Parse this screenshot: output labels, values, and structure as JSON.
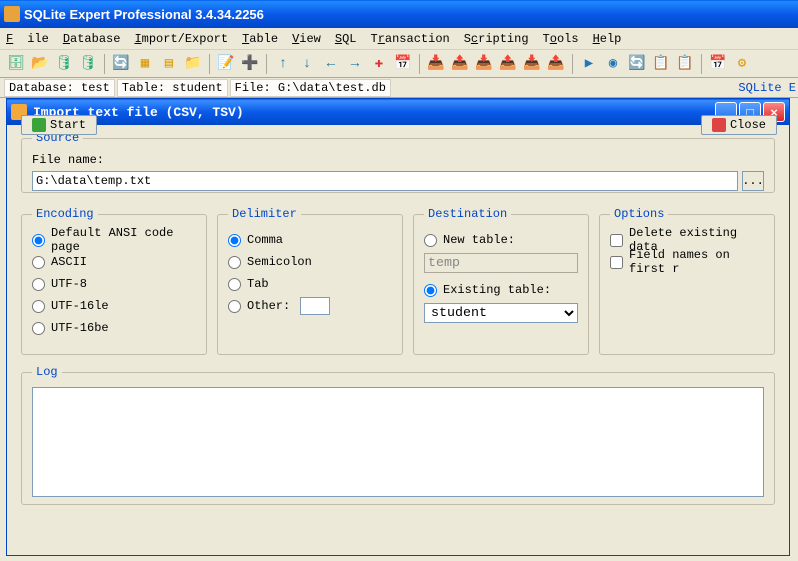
{
  "app": {
    "title": "SQLite Expert Professional 3.4.34.2256"
  },
  "menu": {
    "file": "File",
    "database": "Database",
    "import_export": "Import/Export",
    "table": "Table",
    "view": "View",
    "sql": "SQL",
    "transaction": "Transaction",
    "scripting": "Scripting",
    "tools": "Tools",
    "help": "Help"
  },
  "statusbar": {
    "database_label": "Database:",
    "database_value": "test",
    "table_label": "Table:",
    "table_value": "student",
    "file_label": "File:",
    "file_value": "G:\\data\\test.db",
    "brand": "SQLite E"
  },
  "dialog": {
    "title": "Import text file (CSV, TSV)",
    "source": {
      "legend": "Source",
      "file_name_label": "File name:",
      "file_name_value": "G:\\data\\temp.txt",
      "browse_label": "..."
    },
    "encoding": {
      "legend": "Encoding",
      "options": [
        {
          "label": "Default ANSI code page",
          "checked": true
        },
        {
          "label": "ASCII",
          "checked": false
        },
        {
          "label": "UTF-8",
          "checked": false
        },
        {
          "label": "UTF-16le",
          "checked": false
        },
        {
          "label": "UTF-16be",
          "checked": false
        }
      ]
    },
    "delimiter": {
      "legend": "Delimiter",
      "options": [
        {
          "label": "Comma",
          "checked": true
        },
        {
          "label": "Semicolon",
          "checked": false
        },
        {
          "label": "Tab",
          "checked": false
        },
        {
          "label": "Other:",
          "checked": false
        }
      ],
      "other_value": ""
    },
    "destination": {
      "legend": "Destination",
      "new_table_label": "New table:",
      "new_table_value": "temp",
      "new_table_checked": false,
      "existing_table_label": "Existing table:",
      "existing_table_checked": true,
      "existing_table_value": "student"
    },
    "options": {
      "legend": "Options",
      "delete_existing_label": "Delete existing data",
      "delete_existing_checked": false,
      "field_names_label": "Field names on first r",
      "field_names_checked": false
    },
    "log": {
      "legend": "Log",
      "value": ""
    },
    "buttons": {
      "start": "Start",
      "close": "Close"
    }
  }
}
